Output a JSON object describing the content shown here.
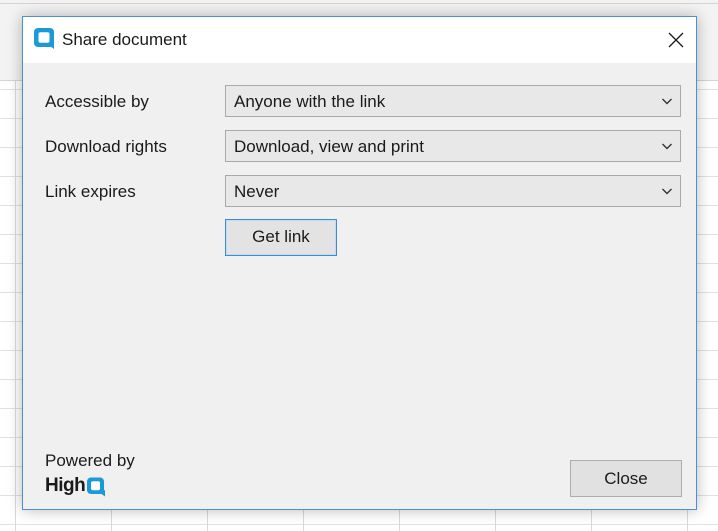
{
  "dialog": {
    "title": "Share document",
    "title_icon": "highq-q-logo-icon",
    "close_icon": "close-x-icon"
  },
  "form": {
    "accessible_by": {
      "label": "Accessible by",
      "value": "Anyone with the link"
    },
    "download_rights": {
      "label": "Download rights",
      "value": "Download, view and print"
    },
    "link_expires": {
      "label": "Link expires",
      "value": "Never"
    },
    "chevron_icon": "chevron-down-icon"
  },
  "actions": {
    "get_link_label": "Get link",
    "close_label": "Close"
  },
  "footer": {
    "powered_by": "Powered by",
    "brand_text": "High",
    "brand_mark_text": "Q"
  },
  "colors": {
    "brand_accent": "#1a9bd7",
    "focus_border": "#3f8bd6",
    "dialog_background": "#f0f0f0"
  }
}
